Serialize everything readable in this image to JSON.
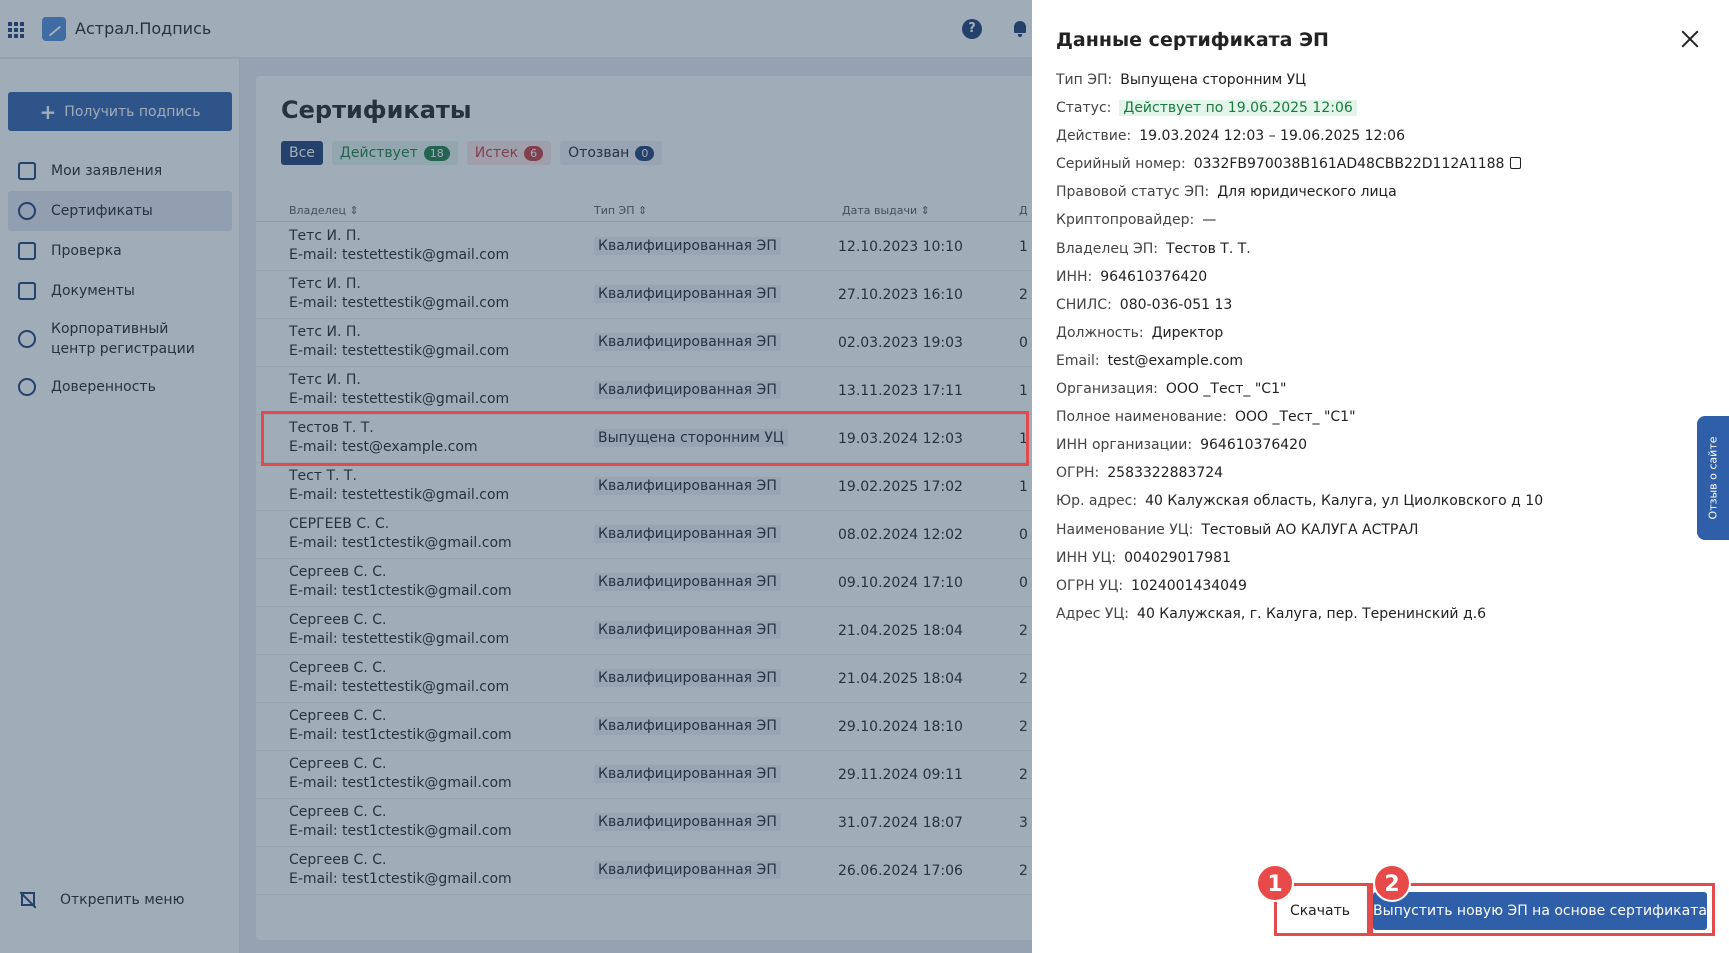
{
  "app": {
    "title": "Астрал.Подпись"
  },
  "sidebar": {
    "get_sign_label": "Получить подпись",
    "items": [
      {
        "label": "Мои заявления",
        "icon": "copy-icon"
      },
      {
        "label": "Сертификаты",
        "icon": "ribbon-icon"
      },
      {
        "label": "Проверка",
        "icon": "check-icon"
      },
      {
        "label": "Документы",
        "icon": "document-icon"
      },
      {
        "label": "Корпоративный центр регистрации",
        "icon": "chat-icon"
      },
      {
        "label": "Доверенность",
        "icon": "shield-icon"
      }
    ],
    "unpin_label": "Открепить меню"
  },
  "main": {
    "title": "Сертификаты",
    "filters": [
      {
        "label": "Все",
        "count": ""
      },
      {
        "label": "Действует",
        "count": "18"
      },
      {
        "label": "Истек",
        "count": "6"
      },
      {
        "label": "Отозван",
        "count": "0"
      }
    ],
    "columns": {
      "owner": "Владелец ⇕",
      "type": "Тип ЭП ⇕",
      "date": "Дата выдачи ⇕",
      "extra": "Д"
    },
    "rows": [
      {
        "name": "Тетс И. П.",
        "email": "E-mail: testettestik@gmail.com",
        "type": "Квалифицированная ЭП",
        "date": "12.10.2023 10:10",
        "extra": "1"
      },
      {
        "name": "Тетс И. П.",
        "email": "E-mail: testettestik@gmail.com",
        "type": "Квалифицированная ЭП",
        "date": "27.10.2023 16:10",
        "extra": "2"
      },
      {
        "name": "Тетс И. П.",
        "email": "E-mail: testettestik@gmail.com",
        "type": "Квалифицированная ЭП",
        "date": "02.03.2023 19:03",
        "extra": "0"
      },
      {
        "name": "Тетс И. П.",
        "email": "E-mail: testettestik@gmail.com",
        "type": "Квалифицированная ЭП",
        "date": "13.11.2023 17:11",
        "extra": "1"
      },
      {
        "name": "Тестов Т. Т.",
        "email": "E-mail: test@example.com",
        "type": "Выпущена сторонним УЦ",
        "date": "19.03.2024 12:03",
        "extra": "1"
      },
      {
        "name": "Тест Т. Т.",
        "email": "E-mail: testettestik@gmail.com",
        "type": "Квалифицированная ЭП",
        "date": "19.02.2025 17:02",
        "extra": "1"
      },
      {
        "name": "СЕРГЕЕВ С. С.",
        "email": "E-mail: test1ctestik@gmail.com",
        "type": "Квалифицированная ЭП",
        "date": "08.02.2024 12:02",
        "extra": "0"
      },
      {
        "name": "Сергеев С. С.",
        "email": "E-mail: test1ctestik@gmail.com",
        "type": "Квалифицированная ЭП",
        "date": "09.10.2024 17:10",
        "extra": "0"
      },
      {
        "name": "Сергеев С. С.",
        "email": "E-mail: testettestik@gmail.com",
        "type": "Квалифицированная ЭП",
        "date": "21.04.2025 18:04",
        "extra": "2"
      },
      {
        "name": "Сергеев С. С.",
        "email": "E-mail: testettestik@gmail.com",
        "type": "Квалифицированная ЭП",
        "date": "21.04.2025 18:04",
        "extra": "2"
      },
      {
        "name": "Сергеев С. С.",
        "email": "E-mail: test1ctestik@gmail.com",
        "type": "Квалифицированная ЭП",
        "date": "29.10.2024 18:10",
        "extra": "2"
      },
      {
        "name": "Сергеев С. С.",
        "email": "E-mail: test1ctestik@gmail.com",
        "type": "Квалифицированная ЭП",
        "date": "29.11.2024 09:11",
        "extra": "2"
      },
      {
        "name": "Сергеев С. С.",
        "email": "E-mail: test1ctestik@gmail.com",
        "type": "Квалифицированная ЭП",
        "date": "31.07.2024 18:07",
        "extra": "3"
      },
      {
        "name": "Сергеев С. С.",
        "email": "E-mail: test1ctestik@gmail.com",
        "type": "Квалифицированная ЭП",
        "date": "26.06.2024 17:06",
        "extra": "2"
      }
    ]
  },
  "panel": {
    "title": "Данные сертификата ЭП",
    "fields": [
      {
        "label": "Тип ЭП:",
        "value": "Выпущена сторонним УЦ"
      },
      {
        "label": "Статус:",
        "value": "Действует по 19.06.2025 12:06"
      },
      {
        "label": "Действие:",
        "value": "19.03.2024 12:03 – 19.06.2025 12:06"
      },
      {
        "label": "Серийный номер:",
        "value": "0332FB970038B161AD48CBB22D112A1188"
      },
      {
        "label": "Правовой статус ЭП:",
        "value": "Для юридического лица"
      },
      {
        "label": "Криптопровайдер:",
        "value": "—"
      },
      {
        "label": "Владелец ЭП:",
        "value": "Тестов Т. Т."
      },
      {
        "label": "ИНН:",
        "value": "964610376420"
      },
      {
        "label": "СНИЛС:",
        "value": "080-036-051 13"
      },
      {
        "label": "Должность:",
        "value": "Директор"
      },
      {
        "label": "Email:",
        "value": "test@example.com"
      },
      {
        "label": "Организация:",
        "value": "ООО _Тест_ \"С1\""
      },
      {
        "label": "Полное наименование:",
        "value": "ООО _Тест_ \"С1\""
      },
      {
        "label": "ИНН организации:",
        "value": "964610376420"
      },
      {
        "label": "ОГРН:",
        "value": "2583322883724"
      },
      {
        "label": "Юр. адрес:",
        "value": "40 Калужская область, Калуга, ул Циолковского д 10"
      },
      {
        "label": "Наименование УЦ:",
        "value": "Тестовый АО КАЛУГА АСТРАЛ"
      },
      {
        "label": "ИНН УЦ:",
        "value": "004029017981"
      },
      {
        "label": "ОГРН УЦ:",
        "value": "1024001434049"
      },
      {
        "label": "Адрес УЦ:",
        "value": "40 Калужская, г. Калуга, пер. Теренинский д.6"
      }
    ],
    "download_label": "Скачать",
    "issue_label": "Выпустить новую ЭП на основе сертификата",
    "feedback_label": "Отзыв о сайте",
    "badge1": "1",
    "badge2": "2"
  },
  "colors": {
    "accent": "#2f5fa8",
    "highlight": "#e24b4b",
    "status_green": "#1a7a3e"
  }
}
